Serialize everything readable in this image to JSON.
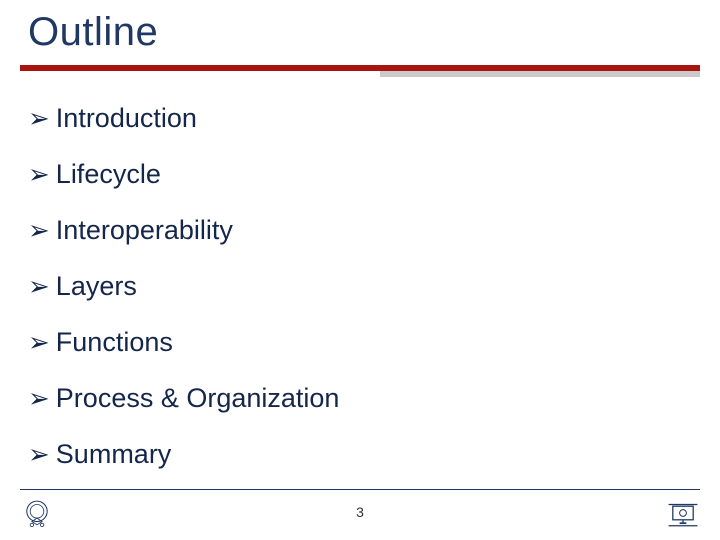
{
  "title": "Outline",
  "items": [
    {
      "label": "Introduction"
    },
    {
      "label": "Lifecycle"
    },
    {
      "label": "Interoperability"
    },
    {
      "label": "Layers"
    },
    {
      "label": "Functions"
    },
    {
      "label": "Process & Organization"
    },
    {
      "label": "Summary"
    }
  ],
  "page_number": "3",
  "colors": {
    "accent": "#a8150f",
    "text": "#1f3864"
  }
}
